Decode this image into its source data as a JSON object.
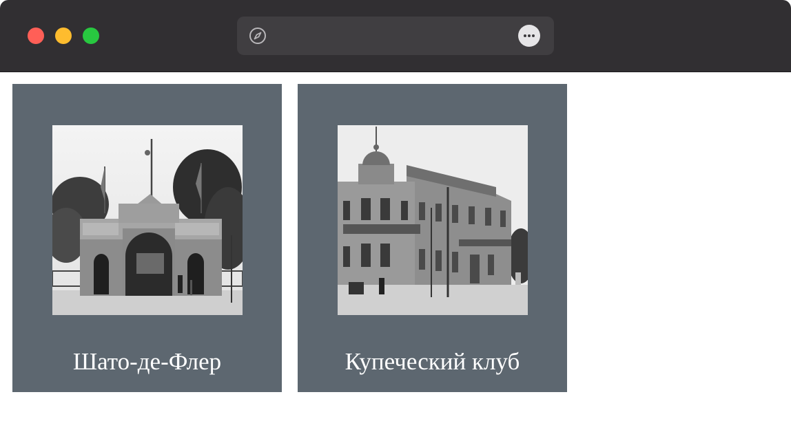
{
  "window": {
    "controls": [
      "close",
      "minimize",
      "zoom"
    ],
    "colors": {
      "close": "#ff5f57",
      "minimize": "#febc2e",
      "zoom": "#28c840",
      "titlebar": "#312f32"
    }
  },
  "addressbar": {
    "url": "",
    "left_icon": "compass-icon",
    "right_icon": "more-options-icon"
  },
  "cards": [
    {
      "caption": "Шато-де-Флер",
      "image_icon": "chateau-de-fleurs-gate-photo"
    },
    {
      "caption": "Купеческий клуб",
      "image_icon": "merchant-club-building-photo"
    }
  ],
  "colors": {
    "card_background": "#5d6770",
    "caption_text": "#ffffff"
  }
}
